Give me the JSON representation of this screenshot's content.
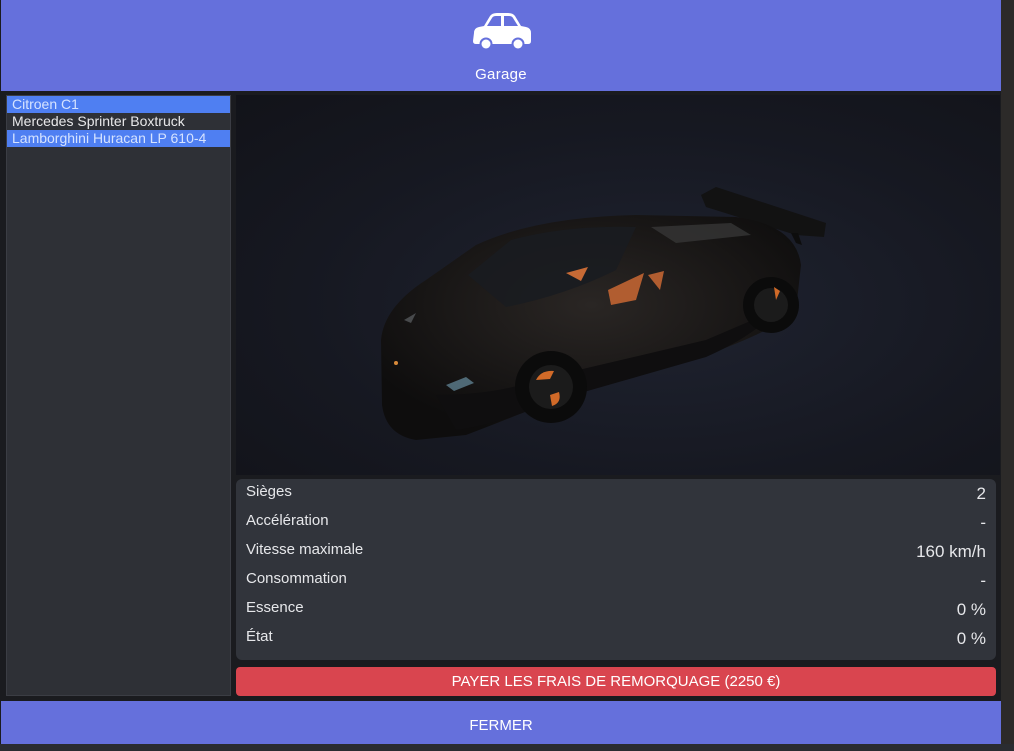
{
  "header": {
    "icon": "car-icon",
    "title": "Garage",
    "color": "#6570dc"
  },
  "vehicles": [
    {
      "label": "Citroen C1",
      "selected": true
    },
    {
      "label": "Mercedes Sprinter Boxtruck",
      "selected": false
    },
    {
      "label": "Lamborghini Huracan LP 610-4",
      "selected": true
    }
  ],
  "stats": [
    {
      "label": "Sièges",
      "value": "2"
    },
    {
      "label": "Accélération",
      "value": "-"
    },
    {
      "label": "Vitesse maximale",
      "value": "160 km/h"
    },
    {
      "label": "Consommation",
      "value": "-"
    },
    {
      "label": "Essence",
      "value": "0 %"
    },
    {
      "label": "État",
      "value": "0 %"
    }
  ],
  "actions": {
    "pay_label": "PAYER LES FRAIS DE REMORQUAGE (2250 €)",
    "close_label": "FERMER"
  },
  "colors": {
    "accent": "#6570dc",
    "selected": "#4f7ff2",
    "danger": "#d9454f"
  }
}
